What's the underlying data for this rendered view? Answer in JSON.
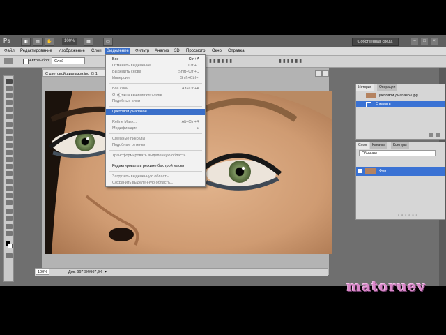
{
  "app": {
    "logo": "Ps",
    "zoom": "100%",
    "workspace_button": "Собственная среда"
  },
  "menubar": {
    "items": [
      "Файл",
      "Редактирование",
      "Изображение",
      "Слои",
      "Выделение",
      "Фильтр",
      "Анализ",
      "3D",
      "Просмотр",
      "Окно",
      "Справка"
    ],
    "active": "Выделение"
  },
  "options": {
    "autoselect_label": "Автовыбор:",
    "autoselect_value": "Слой"
  },
  "document": {
    "tab_title": "С цветовой диапазон.jpg @ 1",
    "zoom": "100%",
    "status": "Док: 667,9K/667,9K"
  },
  "select_menu": {
    "items": [
      {
        "label": "Все",
        "shortcut": "Ctrl+A",
        "disabled": false
      },
      {
        "label": "Отменить выделение",
        "shortcut": "Ctrl+D",
        "disabled": true
      },
      {
        "label": "Выделить снова",
        "shortcut": "Shift+Ctrl+D",
        "disabled": true
      },
      {
        "label": "Инверсия",
        "shortcut": "Shift+Ctrl+I",
        "disabled": true
      },
      {
        "label": "Все слои",
        "shortcut": "Alt+Ctrl+A",
        "disabled": true
      },
      {
        "label": "Отменить выделение слоев",
        "shortcut": "",
        "disabled": true
      },
      {
        "label": "Подобные слои",
        "shortcut": "",
        "disabled": true
      },
      {
        "label": "Цветовой диапазон...",
        "shortcut": "",
        "disabled": false,
        "highlighted": true
      },
      {
        "label": "Refine Mask...",
        "shortcut": "Alt+Ctrl+R",
        "disabled": true
      },
      {
        "label": "Модификация",
        "shortcut": "",
        "disabled": true,
        "submenu": true
      },
      {
        "label": "Смежные пикселы",
        "shortcut": "",
        "disabled": true
      },
      {
        "label": "Подобные оттенки",
        "shortcut": "",
        "disabled": true
      },
      {
        "label": "Трансформировать выделенную область",
        "shortcut": "",
        "disabled": true
      },
      {
        "label": "Редактировать в режиме быстрой маски",
        "shortcut": "",
        "disabled": false
      },
      {
        "label": "Загрузить выделенную область...",
        "shortcut": "",
        "disabled": true
      },
      {
        "label": "Сохранить выделенную область...",
        "shortcut": "",
        "disabled": true
      }
    ]
  },
  "history_panel": {
    "tabs": [
      "История",
      "Операции"
    ],
    "snapshot": "цветовой диапазон.jpg",
    "steps": [
      "Открыть"
    ]
  },
  "layers_panel": {
    "tabs": [
      "Слои",
      "Каналы",
      "Контуры"
    ],
    "blend_mode": "Обычные",
    "layers": [
      "Фон"
    ]
  },
  "watermark": "matoruev"
}
